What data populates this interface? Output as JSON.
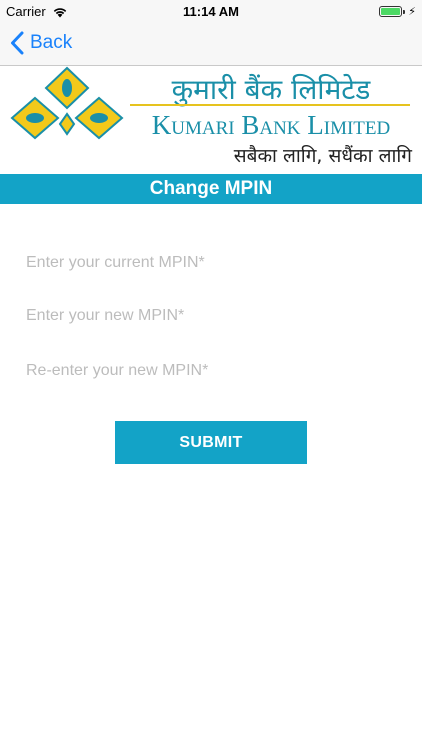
{
  "status_bar": {
    "carrier": "Carrier",
    "time": "11:14 AM",
    "wifi_icon": "wifi-icon",
    "battery_icon": "battery-icon",
    "charging_icon": "charging-bolt-icon"
  },
  "nav": {
    "back_label": "Back",
    "back_icon": "chevron-left-icon"
  },
  "logo": {
    "nepali_name": "कुमारी बैंक लिमिटेड",
    "english_name": "Kumari Bank Limited",
    "tagline": "सबैका लागि, सधैंका लागि",
    "colors": {
      "brand_teal": "#1a8fa8",
      "brand_yellow": "#f3c91a"
    }
  },
  "page": {
    "title": "Change MPIN"
  },
  "form": {
    "current_mpin_placeholder": "Enter your current MPIN*",
    "new_mpin_placeholder": "Enter your new MPIN*",
    "reenter_mpin_placeholder": "Re-enter your new MPIN*",
    "submit_label": "SUBMIT"
  },
  "colors": {
    "accent": "#13a3c7",
    "ios_blue": "#1a82fb"
  }
}
